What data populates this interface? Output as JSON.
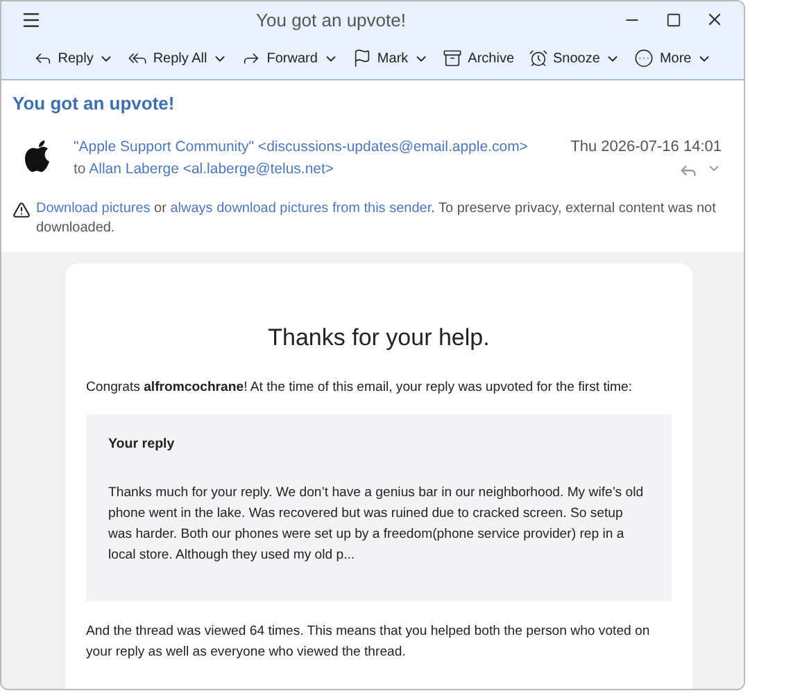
{
  "window": {
    "title": "You got an upvote!"
  },
  "toolbar": [
    {
      "label": "Reply",
      "has_menu": true
    },
    {
      "label": "Reply All",
      "has_menu": true
    },
    {
      "label": "Forward",
      "has_menu": true
    },
    {
      "label": "Mark",
      "has_menu": true
    },
    {
      "label": "Archive",
      "has_menu": false
    },
    {
      "label": "Snooze",
      "has_menu": true
    },
    {
      "label": "More",
      "has_menu": true
    }
  ],
  "subject": "You got an upvote!",
  "header": {
    "from": "\"Apple Support Community\" <discussions-updates@email.apple.com>",
    "to_prefix": "to",
    "to": "Allan Laberge <al.laberge@telus.net>",
    "date": "Thu 2026-07-16 14:01"
  },
  "notice": {
    "link_1": "Download pictures",
    "joiner": "or",
    "link_2": "always download pictures from this sender",
    "rest": ". To preserve privacy, external content was not downloaded."
  },
  "message": {
    "heading": "Thanks for your help.",
    "intro": "Congrats **alfromcochrane**! At the time of this email, your reply was upvoted for the first time:",
    "quote_title": "Your reply",
    "quote_text": "Thanks much for your reply. We don’t have a genius bar in our neighborhood. My wife’s old phone went in the lake. Was recovered but was ruined due to cracked screen. So setup was harder. Both our phones were set up by a freedom(phone service provider) rep in a local store. Although they used my old p...",
    "outro": "And the thread was viewed 64 times. This means that you helped both the person who voted on your reply as well as everyone who viewed the thread."
  }
}
